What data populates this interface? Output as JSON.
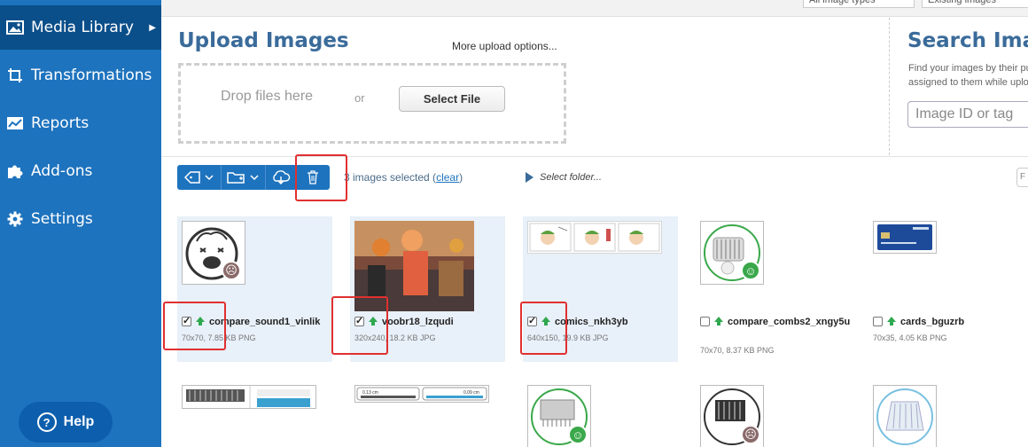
{
  "sidebar": {
    "items": [
      {
        "label": "Media Library",
        "icon": "image-icon",
        "active": true
      },
      {
        "label": "Transformations",
        "icon": "crop-icon",
        "active": false
      },
      {
        "label": "Reports",
        "icon": "chart-icon",
        "active": false
      },
      {
        "label": "Add-ons",
        "icon": "puzzle-icon",
        "active": false
      },
      {
        "label": "Settings",
        "icon": "gear-icon",
        "active": false
      }
    ],
    "help_label": "Help"
  },
  "top_filters": {
    "image_types": "All image types",
    "existing_images": "Existing images"
  },
  "upload": {
    "title": "Upload Images",
    "more_options": "More upload options...",
    "drop_text": "Drop files here",
    "or_text": "or",
    "select_file": "Select File"
  },
  "search": {
    "title": "Search Images",
    "description_line1": "Find your images by their public ID",
    "description_line2": "assigned to them while uploading",
    "placeholder": "Image ID or tag"
  },
  "toolbar": {
    "selected_text": "3 images selected (",
    "clear_link": "clear",
    "selected_close": ")",
    "select_folder": "Select folder...",
    "right_stub": "F"
  },
  "images": [
    {
      "name": "compare_sound1_vinlik",
      "meta": "70x70, 7.85 KB PNG",
      "checked": true
    },
    {
      "name": "voobr18_lzqudi",
      "meta": "320x240, 18.2 KB JPG",
      "checked": true
    },
    {
      "name": "comics_nkh3yb",
      "meta": "640x150, 19.9 KB JPG",
      "checked": true
    },
    {
      "name": "compare_combs2_xngy5u",
      "meta": "70x70, 8.37 KB PNG",
      "checked": false
    },
    {
      "name": "cards_bguzrb",
      "meta": "70x35, 4.05 KB PNG",
      "checked": false
    }
  ],
  "row2_thumbs": {
    "ruler_left": "0.13 cm",
    "ruler_right": "0.09 cm"
  },
  "colors": {
    "sidebar": "#1e73be",
    "sidebar_active": "#0b4f8a",
    "accent_title": "#3a6b9a",
    "selected_card": "#e8f0f9",
    "highlight_box": "#e03030",
    "upload_green": "#2fa84f"
  }
}
